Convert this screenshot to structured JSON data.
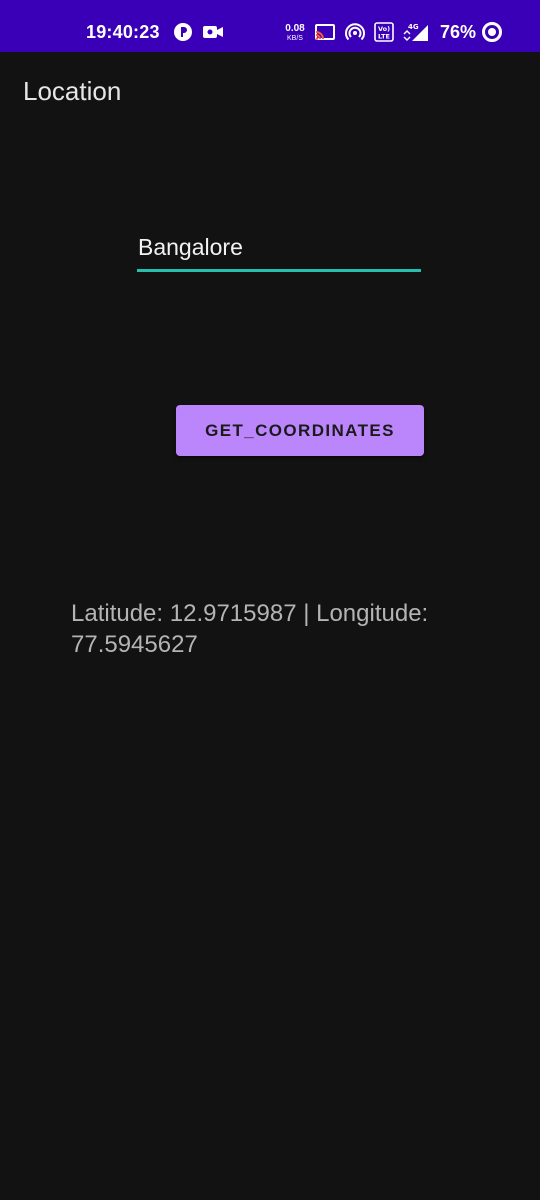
{
  "status_bar": {
    "time": "19:40:23",
    "net_speed_value": "0.08",
    "net_speed_unit": "KB/S",
    "network_type": "4G",
    "battery": "76%",
    "icons": [
      "notification-app-icon",
      "screen-record-icon",
      "cast-icon",
      "hotspot-icon",
      "volte-icon",
      "signal-icon",
      "battery-ring-icon"
    ],
    "background_color": "#3a00b8"
  },
  "app_bar": {
    "title": "Location"
  },
  "city_input": {
    "value": "Bangalore",
    "underline_color": "#26bfae"
  },
  "get_coordinates_button": {
    "label": "GET_COORDINATES",
    "color": "#bb86fc"
  },
  "result": {
    "text": "Latitude: 12.9715987 | Longitude: 77.5945627"
  }
}
